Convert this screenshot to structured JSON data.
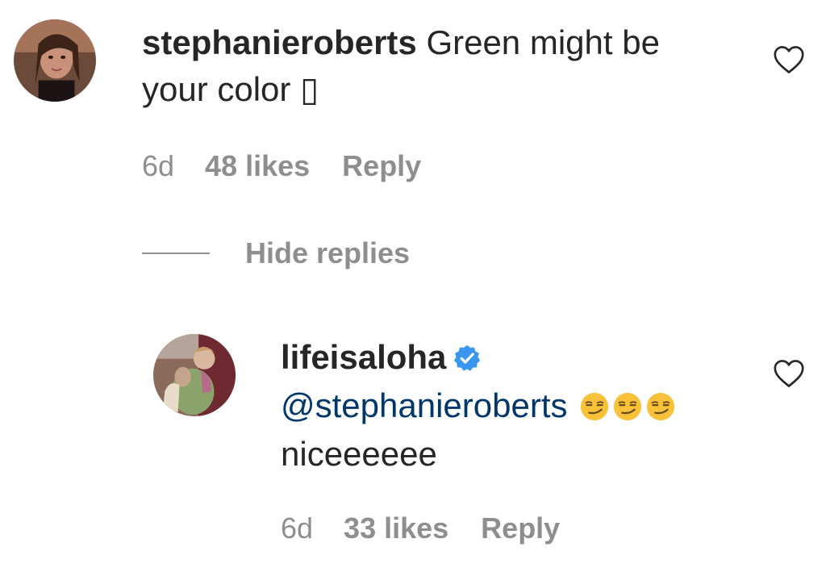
{
  "comment": {
    "username": "stephanieroberts",
    "text_line1": "Green might be",
    "text_line2": "your color ▯",
    "time": "6d",
    "likes": "48 likes",
    "reply_label": "Reply",
    "avatar_icon": "user-avatar-photo",
    "like_icon": "heart-outline-icon"
  },
  "hide_replies_label": "Hide replies",
  "reply": {
    "username": "lifeisaloha",
    "verified_icon": "verified-badge-icon",
    "mention": "@stephanieroberts",
    "emoji_icon": "smirking-face-emoji",
    "emoji_count": 3,
    "text": "niceeeeee",
    "time": "6d",
    "likes": "33 likes",
    "reply_label": "Reply",
    "avatar_icon": "user-avatar-photo",
    "like_icon": "heart-outline-icon"
  },
  "colors": {
    "primary_text": "#262626",
    "secondary_text": "#8e8e8e",
    "mention": "#00376b",
    "verified_blue": "#3897f0",
    "background": "#ffffff"
  }
}
